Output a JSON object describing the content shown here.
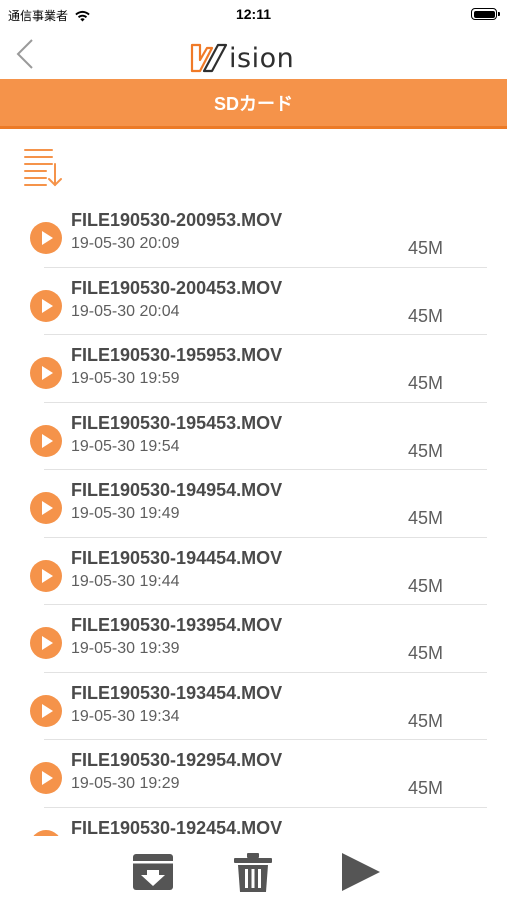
{
  "status_bar": {
    "carrier": "通信事業者",
    "time": "12:11"
  },
  "header": {
    "logo_initial": "V",
    "logo_rest": "ision",
    "title": "SDカード"
  },
  "icons": {
    "back": "chevron-left-icon",
    "sort": "sort-list-icon",
    "download": "download-box-icon",
    "delete": "trash-icon",
    "play": "play-icon"
  },
  "colors": {
    "accent": "#f5934a",
    "accent_dark": "#ec7a26",
    "icon_gray": "#555555"
  },
  "files": [
    {
      "name": "FILE190530-200953.MOV",
      "date": "19-05-30 20:09",
      "size": "45M"
    },
    {
      "name": "FILE190530-200453.MOV",
      "date": "19-05-30 20:04",
      "size": "45M"
    },
    {
      "name": "FILE190530-195953.MOV",
      "date": "19-05-30 19:59",
      "size": "45M"
    },
    {
      "name": "FILE190530-195453.MOV",
      "date": "19-05-30 19:54",
      "size": "45M"
    },
    {
      "name": "FILE190530-194954.MOV",
      "date": "19-05-30 19:49",
      "size": "45M"
    },
    {
      "name": "FILE190530-194454.MOV",
      "date": "19-05-30 19:44",
      "size": "45M"
    },
    {
      "name": "FILE190530-193954.MOV",
      "date": "19-05-30 19:39",
      "size": "45M"
    },
    {
      "name": "FILE190530-193454.MOV",
      "date": "19-05-30 19:34",
      "size": "45M"
    },
    {
      "name": "FILE190530-192954.MOV",
      "date": "19-05-30 19:29",
      "size": "45M"
    },
    {
      "name": "FILE190530-192454.MOV",
      "date": "",
      "size": ""
    }
  ]
}
